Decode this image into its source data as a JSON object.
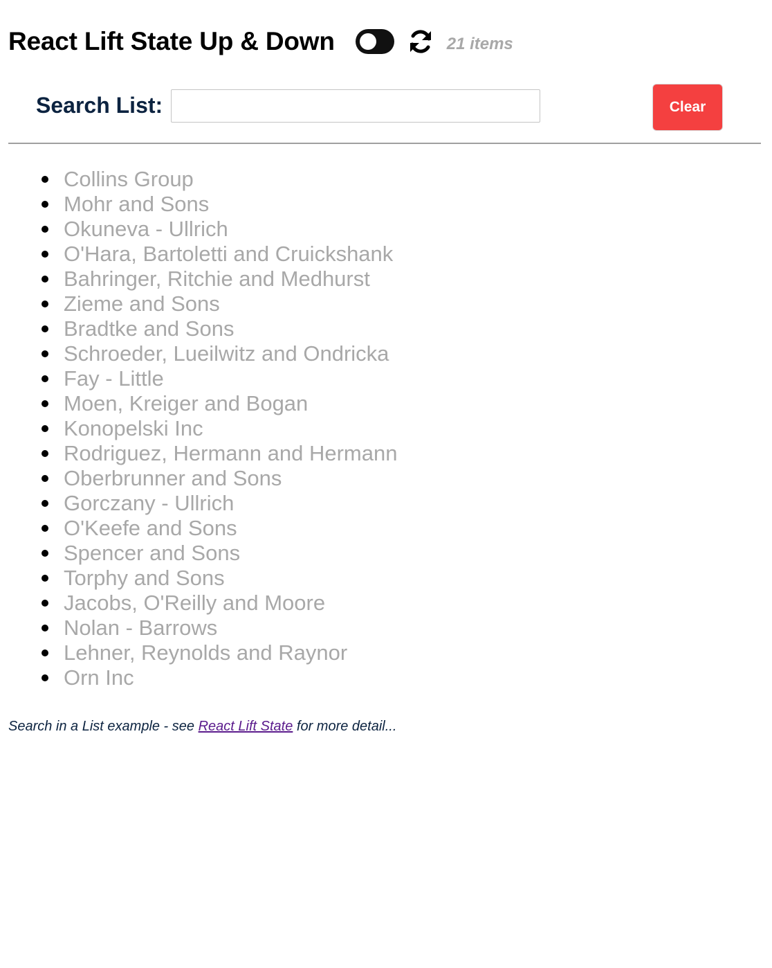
{
  "header": {
    "title": "React Lift State Up & Down",
    "toggle_icon": "toggle-switch-icon",
    "refresh_icon": "refresh-icon",
    "item_count": "21 items"
  },
  "search": {
    "label": "Search List:",
    "value": "",
    "placeholder": "",
    "clear_label": "Clear"
  },
  "list": {
    "items": [
      "Collins Group",
      "Mohr and Sons",
      "Okuneva - Ullrich",
      "O'Hara, Bartoletti and Cruickshank",
      "Bahringer, Ritchie and Medhurst",
      "Zieme and Sons",
      "Bradtke and Sons",
      "Schroeder, Lueilwitz and Ondricka",
      "Fay - Little",
      "Moen, Kreiger and Bogan",
      "Konopelski Inc",
      "Rodriguez, Hermann and Hermann",
      "Oberbrunner and Sons",
      "Gorczany - Ullrich",
      "O'Keefe and Sons",
      "Spencer and Sons",
      "Torphy and Sons",
      "Jacobs, O'Reilly and Moore",
      "Nolan - Barrows",
      "Lehner, Reynolds and Raynor",
      "Orn Inc"
    ]
  },
  "footer": {
    "prefix": "Search in a List example - see ",
    "link_text": "React Lift State",
    "suffix": " for more detail..."
  },
  "colors": {
    "accent_red": "#f44040",
    "list_text": "#a8a8a8",
    "label_navy": "#0c2340",
    "link_purple": "#5a1a8c"
  }
}
